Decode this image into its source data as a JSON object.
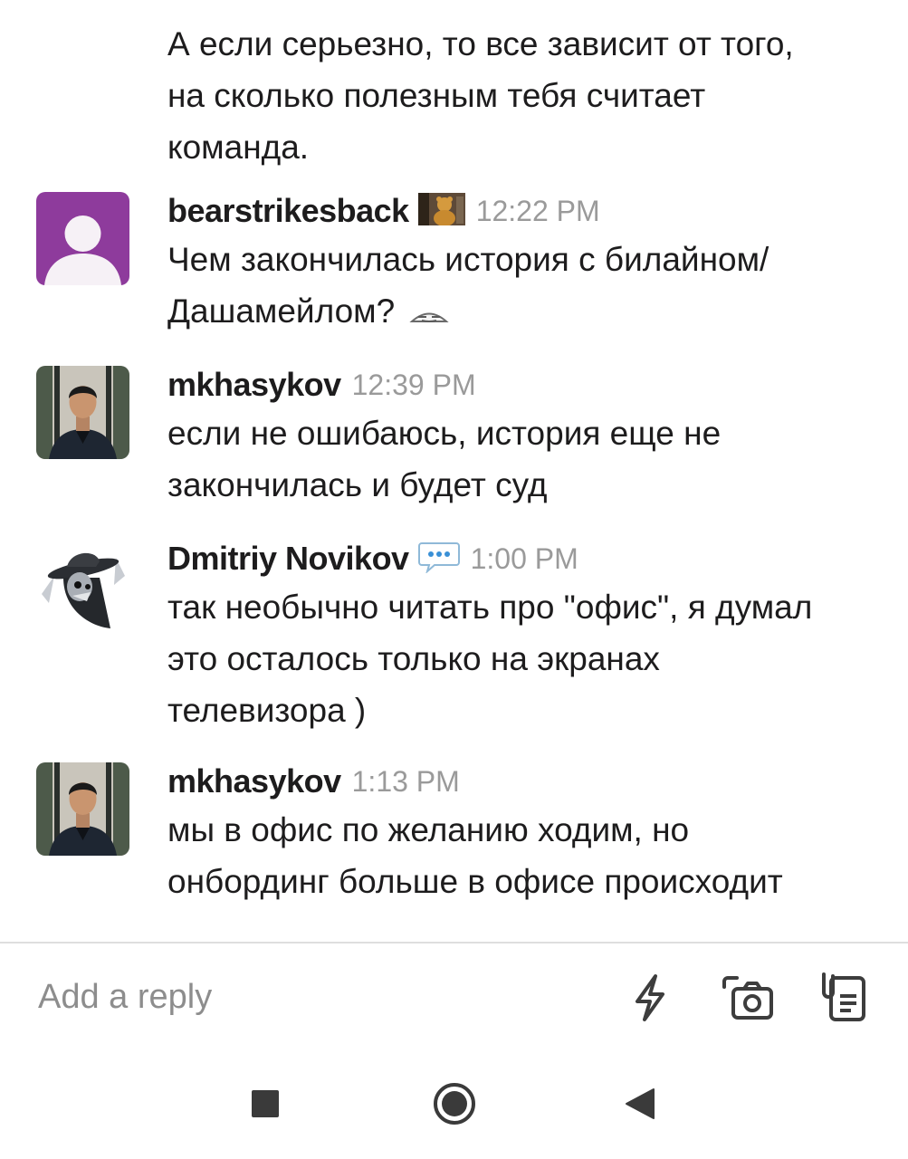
{
  "thread": {
    "prev_message": {
      "lines": [
        "А если серьезно, то все зависит от того,",
        "на сколько полезным тебя считает",
        "команда."
      ]
    },
    "messages": [
      {
        "username": "bearstrikesback",
        "status_emoji": "bear-photo-emoji",
        "time": "12:22 PM",
        "avatar": "default-avatar",
        "avatar_color": "#8e3b9c",
        "lines": [
          "Чем закончилась история с билайном/",
          "Дашамейлом?"
        ],
        "trailing_emoji": "smirk-emoji"
      },
      {
        "username": "mkhasykov",
        "time": "12:39 PM",
        "avatar": "photo-avatar",
        "lines": [
          "если не ошибаюсь, история еще не",
          "закончилась и будет суд"
        ]
      },
      {
        "username": "Dmitriy Novikov",
        "status_emoji": "speech-balloon-emoji",
        "time": "1:00 PM",
        "avatar": "spy-avatar",
        "lines": [
          "так необычно читать про \"офис\", я думал",
          "это осталось только на экранах",
          "телевизора )"
        ]
      },
      {
        "username": "mkhasykov",
        "time": "1:13 PM",
        "avatar": "photo-avatar",
        "lines": [
          "мы в офис по желанию ходим, но",
          "онбординг больше в офисе происходит"
        ]
      }
    ]
  },
  "composer": {
    "placeholder": "Add a reply",
    "icons": [
      "lightning-icon",
      "camera-icon",
      "attachment-icon"
    ]
  },
  "navbar": {
    "buttons": [
      "recents-button",
      "home-button",
      "back-button"
    ]
  }
}
